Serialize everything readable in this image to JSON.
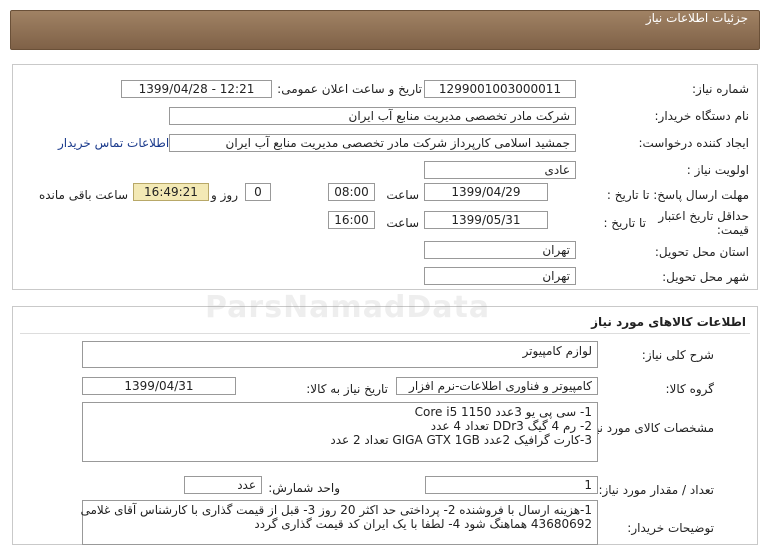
{
  "header": {
    "title": "جزئیات اطلاعات نیاز"
  },
  "details": {
    "need_number_label": "شماره نیاز:",
    "need_number": "1299001003000011",
    "announce_label": "تاریخ و ساعت اعلان عمومی:",
    "announce_value": "1399/04/28 - 12:21",
    "buyer_org_label": "نام دستگاه خریدار:",
    "buyer_org": "شرکت مادر تخصصی مدیریت منابع آب ایران",
    "requester_label": "ایجاد کننده درخواست:",
    "requester": "جمشید  اسلامی کارپرداز شرکت مادر تخصصی مدیریت منابع آب ایران",
    "contact_link": "اطلاعات تماس خریدار",
    "priority_label": "اولویت نیاز :",
    "priority": "عادی",
    "reply_deadline_label": "مهلت ارسال پاسخ: تا تاریخ :",
    "reply_date": "1399/04/29",
    "time_label": "ساعت",
    "reply_time": "08:00",
    "days_value": "0",
    "days_label": "روز و",
    "remaining_time": "16:49:21",
    "remaining_label": "ساعت باقی مانده",
    "price_validity_label_1": "حداقل تاریخ اعتبار",
    "price_validity_label_2": "قیمت:",
    "until_date_label": "تا تاریخ :",
    "validity_date": "1399/05/31",
    "validity_time": "16:00",
    "province_label": "استان محل تحویل:",
    "province": "تهران",
    "city_label": "شهر محل تحویل:",
    "city": "تهران"
  },
  "goods": {
    "section_title": "اطلاعات کالاهای مورد نیاز",
    "summary_label": "شرح کلی نیاز:",
    "summary": "لوازم کامپیوتر",
    "group_label": "گروه کالا:",
    "group": "کامپیوتر و فناوری اطلاعات-نرم افزار",
    "need_date_label": "تاریخ نیاز به کالا:",
    "need_date": "1399/04/31",
    "specs_label": "مشخصات کالای مورد نیاز:",
    "specs": [
      "1- سی پی یو 3عدد Core i5 1150",
      "2- رم 4 گیگ DDr3 تعداد 4 عدد",
      "3-کارت گرافیک 2عدد GIGA GTX 1GB تعداد 2 عدد"
    ],
    "qty_label": "تعداد / مقدار مورد نیاز:",
    "qty": "1",
    "unit_label": "واحد شمارش:",
    "unit": "عدد",
    "buyer_notes_label": "توضیحات خریدار:",
    "buyer_notes": [
      "1-هزینه ارسال با فروشنده 2- پرداختی حد اکثر 20 روز 3- قبل از قیمت گذاری با کارشناس آقای غلامی",
      "43680692 هماهنگ شود 4- لطفا با یک ایران کد قیمت گذاری گردد"
    ]
  },
  "watermark": "ParsNamadData"
}
